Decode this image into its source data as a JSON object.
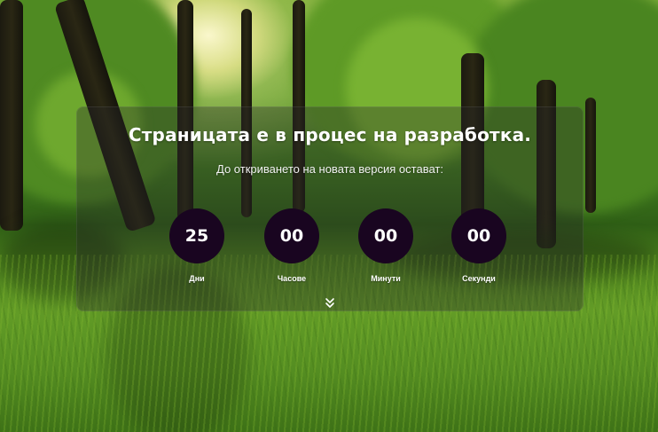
{
  "page": {
    "title": "Страницата е в процес на разработка.",
    "subtitle": "До откриването на новата версия остават:"
  },
  "countdown": [
    {
      "value": "25",
      "label": "Дни"
    },
    {
      "value": "00",
      "label": "Часове"
    },
    {
      "value": "00",
      "label": "Минути"
    },
    {
      "value": "00",
      "label": "Секунди"
    }
  ],
  "icons": {
    "scroll_down": "double-chevron-down-icon"
  },
  "colors": {
    "circle_bg": "#190520",
    "text": "#ffffff",
    "panel_overlay": "rgba(40,40,40,0.35)"
  }
}
